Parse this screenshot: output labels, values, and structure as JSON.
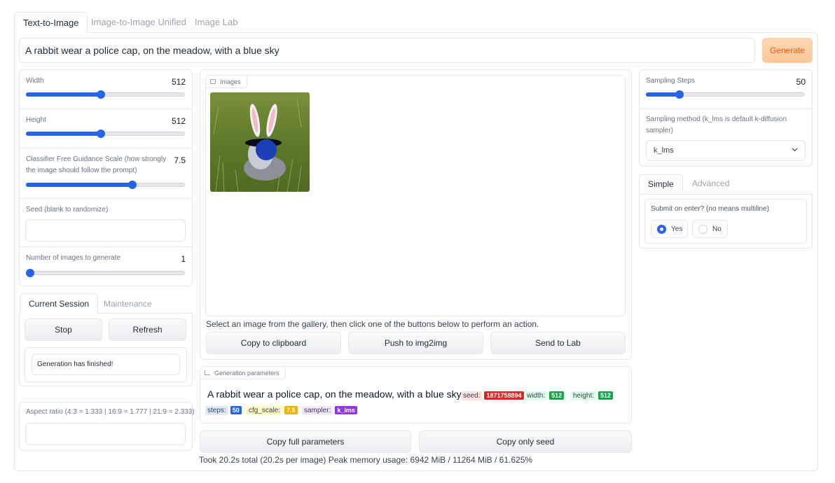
{
  "tabs": [
    "Text-to-Image",
    "Image-to-Image Unified",
    "Image Lab"
  ],
  "prompt": "A rabbit  wear a police cap,  on the meadow, with a blue sky",
  "generate_label": "Generate",
  "sliders": {
    "width": {
      "label": "Width",
      "value": "512"
    },
    "height": {
      "label": "Height",
      "value": "512"
    },
    "cfg": {
      "label": "Classifier Free Guidance Scale (how strongly the image should follow the prompt)",
      "value": "7.5"
    },
    "num_images": {
      "label": "Number of images to generate",
      "value": "1"
    },
    "steps": {
      "label": "Sampling Steps",
      "value": "50"
    }
  },
  "seed_label": "Seed (blank to randomize)",
  "session_tabs": [
    "Current Session",
    "Maintenance"
  ],
  "stop_label": "Stop",
  "refresh_label": "Refresh",
  "status_text": "Generation has finished!",
  "aspect_label": "Aspect ratio (4:3 = 1.333 | 16:9 = 1.777 | 21:9 = 2.333)",
  "gallery": {
    "label": "Images",
    "hint": "Select an image from the gallery, then click one of the buttons below to perform an action.",
    "buttons": [
      "Copy to clipboard",
      "Push to img2img",
      "Send to Lab"
    ]
  },
  "gen_params": {
    "label": "Generation parameters",
    "prompt": "A rabbit wear a police cap, on the meadow, with a blue sky",
    "chips": [
      {
        "key": "seed:",
        "value": "1871758894",
        "bg": "#fee2e2",
        "color": "#dc2626"
      },
      {
        "key": "width:",
        "value": "512",
        "bg": "#dcfce7",
        "color": "#16a34a"
      },
      {
        "key": "height:",
        "value": "512",
        "bg": "#dcfce7",
        "color": "#16a34a"
      },
      {
        "key": "steps:",
        "value": "50",
        "bg": "#dbeafe",
        "color": "#2563eb"
      },
      {
        "key": "cfg_scale:",
        "value": "7.5",
        "bg": "#fef9c3",
        "color": "#eab308"
      },
      {
        "key": "sampler:",
        "value": "k_lms",
        "bg": "#f3e8ff",
        "color": "#9333ea"
      }
    ]
  },
  "copy_full_label": "Copy full parameters",
  "copy_seed_label": "Copy only seed",
  "timing": "Took 20.2s total (20.2s per image) Peak memory usage: 6942 MiB / 11264 MiB / 61.625%",
  "sampler": {
    "label": "Sampling method (k_lms is default k-diffusion sampler)",
    "value": "k_lms"
  },
  "mode_tabs": [
    "Simple",
    "Advanced"
  ],
  "submit": {
    "label": "Submit on enter? (no means multiline)",
    "yes": "Yes",
    "no": "No"
  },
  "progress_levels": {
    "width": 0.47,
    "height": 0.47,
    "cfg": 0.67,
    "num_images": 0.02,
    "steps": 0.21
  },
  "colors": {
    "accent": "#2563eb",
    "generate_text": "#ea580c"
  }
}
